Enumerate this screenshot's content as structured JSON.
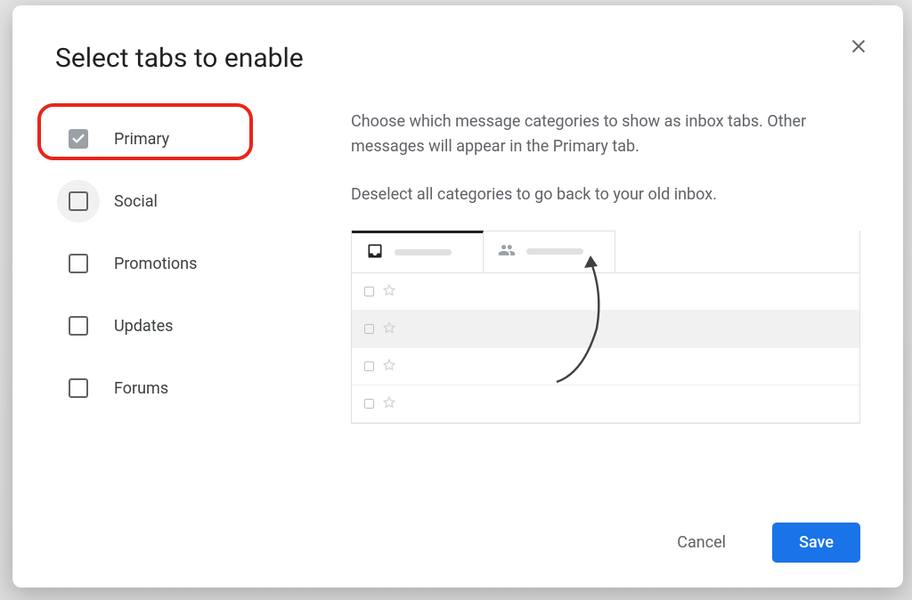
{
  "dialog": {
    "title": "Select tabs to enable",
    "description1": "Choose which message categories to show as inbox tabs. Other messages will appear in the Primary tab.",
    "description2": "Deselect all categories to go back to your old inbox.",
    "categories": [
      {
        "label": "Primary",
        "checked": true,
        "disabled": true
      },
      {
        "label": "Social",
        "checked": false,
        "disabled": false
      },
      {
        "label": "Promotions",
        "checked": false,
        "disabled": false
      },
      {
        "label": "Updates",
        "checked": false,
        "disabled": false
      },
      {
        "label": "Forums",
        "checked": false,
        "disabled": false
      }
    ],
    "actions": {
      "cancel_label": "Cancel",
      "save_label": "Save"
    }
  }
}
